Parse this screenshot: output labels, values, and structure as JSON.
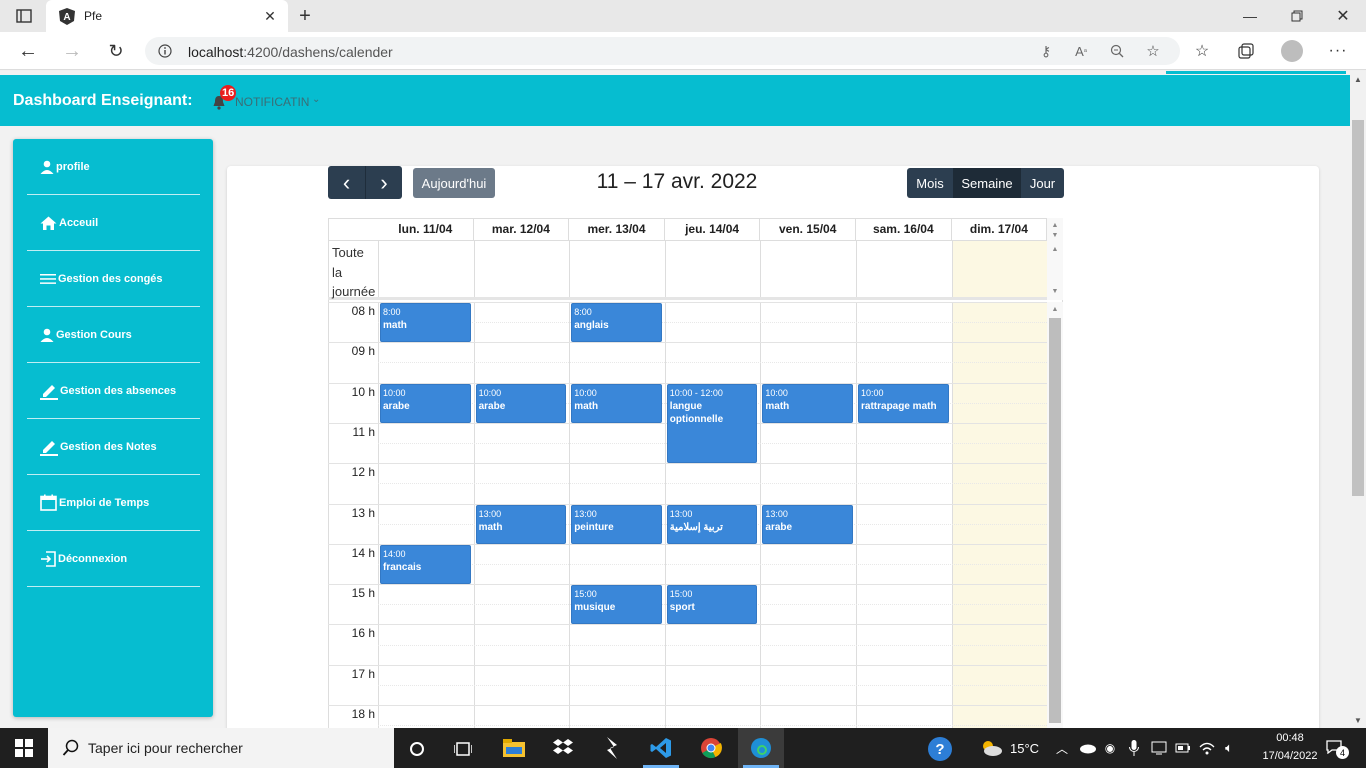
{
  "browser": {
    "tab_title": "Pfe",
    "url_host": "localhost",
    "url_path": ":4200/dashens/calender"
  },
  "topnav": {
    "title": "Dashboard Enseignant:",
    "notif_count": "16",
    "notif_label": "NOTIFICATIN"
  },
  "sidebar": {
    "items": [
      {
        "label": "profile",
        "icon": "person-icon"
      },
      {
        "label": "Acceuil",
        "icon": "home-icon"
      },
      {
        "label": "Gestion des congés",
        "icon": "menu-icon"
      },
      {
        "label": "Gestion Cours",
        "icon": "person-icon"
      },
      {
        "label": "Gestion des absences",
        "icon": "pencil-icon"
      },
      {
        "label": "Gestion des Notes",
        "icon": "pencil-icon"
      },
      {
        "label": "Emploi de Temps",
        "icon": "calendar-icon"
      },
      {
        "label": "Déconnexion",
        "icon": "logout-icon"
      }
    ]
  },
  "calendar": {
    "prev_label": "‹",
    "next_label": "›",
    "today_label": "Aujourd'hui",
    "title": "11 – 17 avr. 2022",
    "views": {
      "month": "Mois",
      "week": "Semaine",
      "day": "Jour"
    },
    "active_view": "week",
    "allday_label": "Toute la journée",
    "days": [
      "lun. 11/04",
      "mar. 12/04",
      "mer. 13/04",
      "jeu. 14/04",
      "ven. 15/04",
      "sam. 16/04",
      "dim. 17/04"
    ],
    "today_index": 6,
    "hours": [
      "08 h",
      "09 h",
      "10 h",
      "11 h",
      "12 h",
      "13 h",
      "14 h",
      "15 h",
      "16 h",
      "17 h",
      "18 h"
    ],
    "events": [
      {
        "day": 0,
        "start": 8,
        "end": 9,
        "time": "8:00",
        "title": "math"
      },
      {
        "day": 2,
        "start": 8,
        "end": 9,
        "time": "8:00",
        "title": "anglais"
      },
      {
        "day": 0,
        "start": 10,
        "end": 11,
        "time": "10:00",
        "title": "arabe"
      },
      {
        "day": 1,
        "start": 10,
        "end": 11,
        "time": "10:00",
        "title": "arabe"
      },
      {
        "day": 2,
        "start": 10,
        "end": 11,
        "time": "10:00",
        "title": "math"
      },
      {
        "day": 3,
        "start": 10,
        "end": 12,
        "time": "10:00 - 12:00",
        "title": "langue optionnelle"
      },
      {
        "day": 4,
        "start": 10,
        "end": 11,
        "time": "10:00",
        "title": "math"
      },
      {
        "day": 5,
        "start": 10,
        "end": 11,
        "time": "10:00",
        "title": "rattrapage math"
      },
      {
        "day": 1,
        "start": 13,
        "end": 14,
        "time": "13:00",
        "title": "math"
      },
      {
        "day": 2,
        "start": 13,
        "end": 14,
        "time": "13:00",
        "title": "peinture"
      },
      {
        "day": 3,
        "start": 13,
        "end": 14,
        "time": "13:00",
        "title": "تربية إسلامية"
      },
      {
        "day": 4,
        "start": 13,
        "end": 14,
        "time": "13:00",
        "title": "arabe"
      },
      {
        "day": 0,
        "start": 14,
        "end": 15,
        "time": "14:00",
        "title": "francais"
      },
      {
        "day": 2,
        "start": 15,
        "end": 16,
        "time": "15:00",
        "title": "musique"
      },
      {
        "day": 3,
        "start": 15,
        "end": 16,
        "time": "15:00",
        "title": "sport"
      }
    ],
    "colors": {
      "event": "#3a87d9",
      "today": "#fcf8e3",
      "nav": "#2c3e50",
      "accent": "#06bdd0"
    }
  },
  "taskbar": {
    "search_placeholder": "Taper ici pour rechercher",
    "weather": "15°C",
    "time": "00:48",
    "date": "17/04/2022",
    "notif_count": "4"
  }
}
